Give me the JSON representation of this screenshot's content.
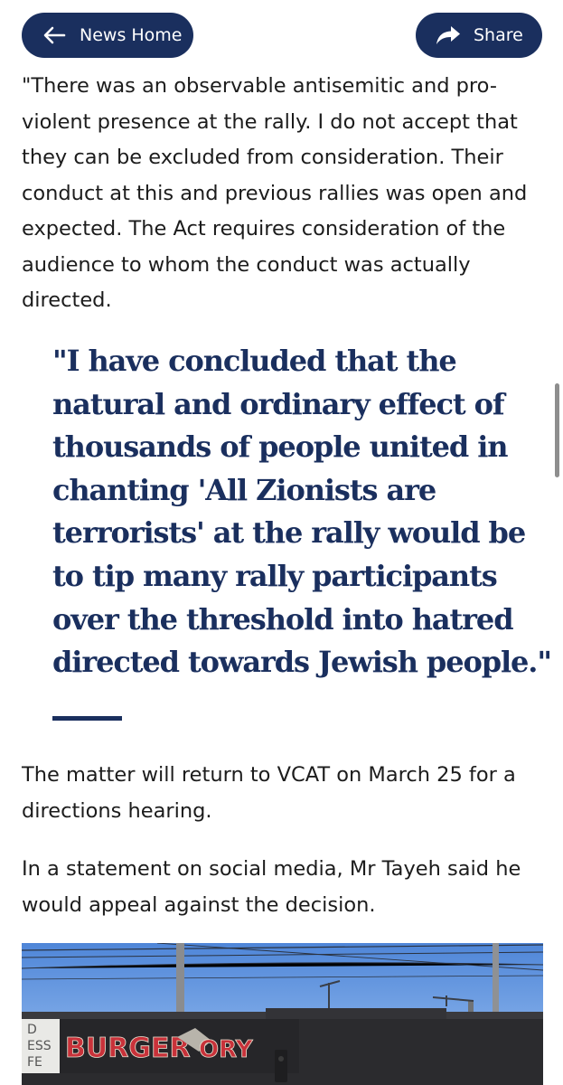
{
  "nav": {
    "back_label": "News Home",
    "share_label": "Share"
  },
  "article": {
    "quote_paragraph": "\"There was an observable antisemitic and pro-violent presence at the rally. I do not accept that they can be excluded from consideration. Their conduct at this and previous rallies was open and expected. The Act requires consideration of the audience to whom the conduct was actually directed.",
    "pull_quote": "\"I have concluded that the natural and ordinary effect of thousands of people united in chanting 'All Zionists are terrorists' at the rally would be to tip many rally participants over the threshold into hatred directed towards Jewish people.\"",
    "paragraph_vcat": "The matter will return to VCAT on March 25 for a directions hearing.",
    "paragraph_tayeh": "In a statement on social media, Mr Tayeh said he would appeal against the decision."
  },
  "photo": {
    "sign_text": "BURGER",
    "sign_text_tail": "ORY",
    "side_sign_lines": [
      "D",
      "ESS",
      "FE"
    ]
  },
  "colors": {
    "brand_navy": "#1a2f5e",
    "body_text": "#1c1c1c",
    "sky": "#5f93dd",
    "sign_red": "#c8323a"
  },
  "icons": {
    "back": "arrow-left-icon",
    "share": "share-arrow-icon"
  }
}
